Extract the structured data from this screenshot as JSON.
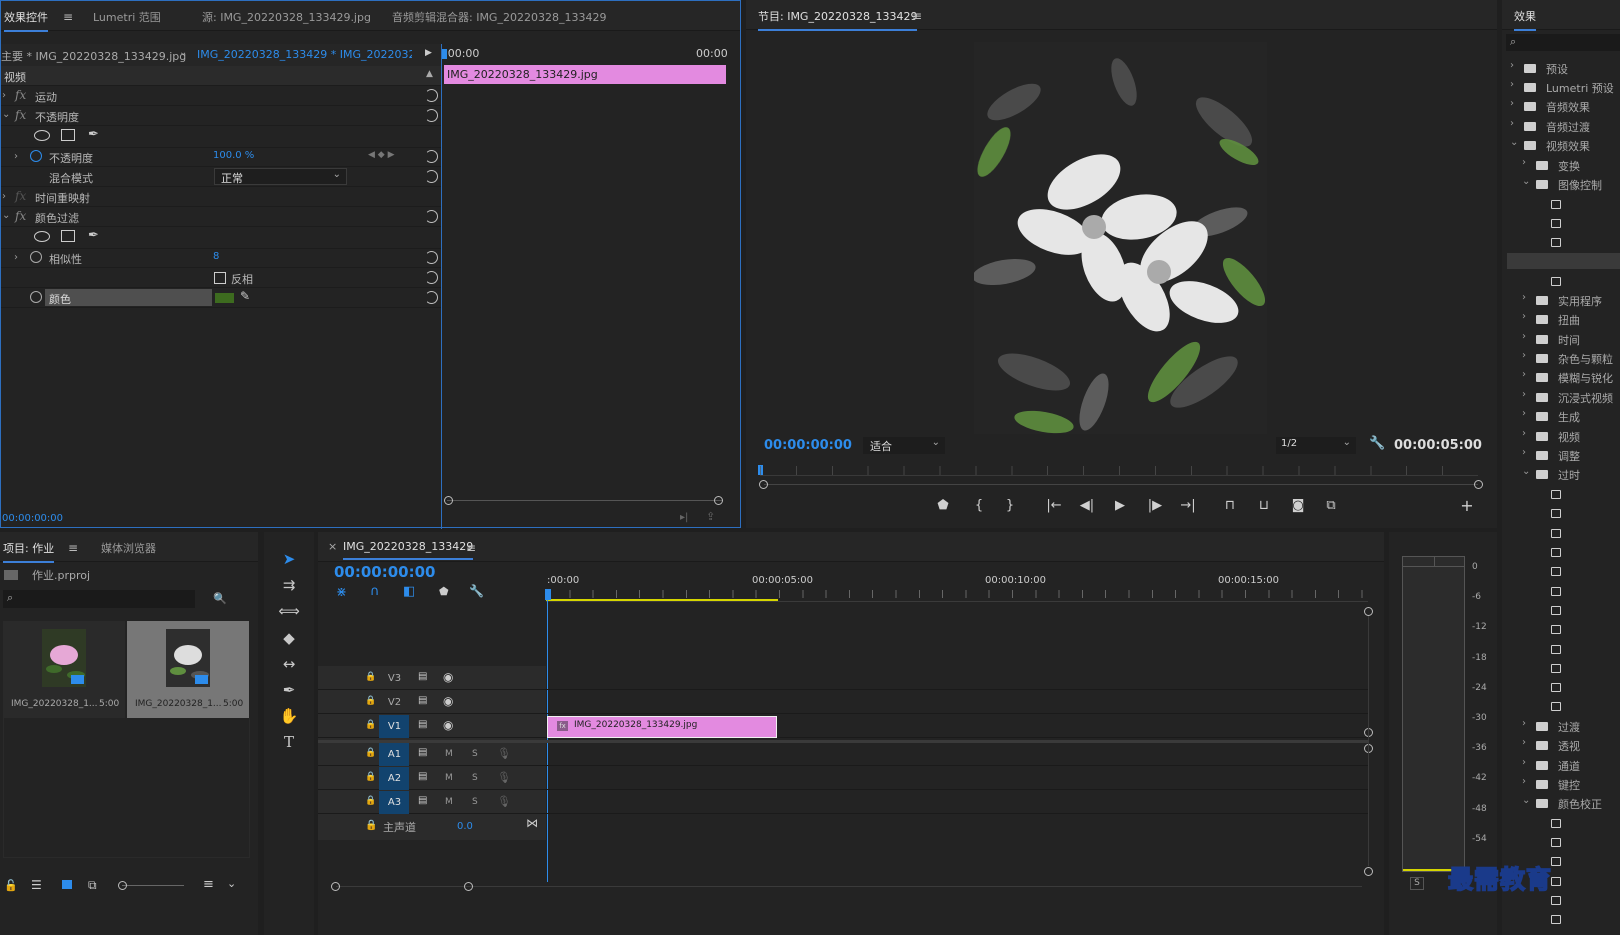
{
  "effects_panel": {
    "tabs": [
      "效果控件",
      "Lumetri 范围",
      "源: IMG_20220328_133429.jpg",
      "音频剪辑混合器: IMG_20220328_133429"
    ],
    "master_clip": "主要 * IMG_20220328_133429.jpg",
    "sequence_clip": "IMG_20220328_133429 * IMG_20220328_...",
    "time_start": ":00:00",
    "time_end": "00:00",
    "clip_bar_label": "IMG_20220328_133429.jpg",
    "section": "视频",
    "effects": {
      "motion": "运动",
      "opacity": "不透明度",
      "opacity_param": "不透明度",
      "opacity_value": "100.0 %",
      "blend_mode_label": "混合模式",
      "blend_mode_value": "正常",
      "time_remap": "时间重映射",
      "color_filter": "颜色过滤",
      "similarity_label": "相似性",
      "similarity_value": "8",
      "invert_label": "反相",
      "color_label": "颜色",
      "color_swatch": "#3d6b1f"
    },
    "footer_time": "00:00:00:00"
  },
  "program_monitor": {
    "title": "节目: IMG_20220328_133429",
    "timecode": "00:00:00:00",
    "zoom": "适合",
    "resolution": "1/2",
    "duration": "00:00:05:00"
  },
  "effects_browser": {
    "title": "效果",
    "items": [
      "预设",
      "Lumetri 预设",
      "音频效果",
      "音频过渡",
      "视频效果",
      "变换",
      "图像控制",
      "实用程序",
      "扭曲",
      "时间",
      "杂色与颗粒",
      "模糊与锐化",
      "沉浸式视频",
      "生成",
      "视频",
      "调整",
      "过时",
      "过渡",
      "透视",
      "通道",
      "键控",
      "颜色校正"
    ]
  },
  "project_panel": {
    "tabs": [
      "项目: 作业",
      "媒体浏览器"
    ],
    "project_file": "作业.prproj",
    "items": [
      {
        "name": "IMG_20220328_1...",
        "duration": "5:00"
      },
      {
        "name": "IMG_20220328_1...",
        "duration": "5:00"
      }
    ]
  },
  "timeline": {
    "title": "IMG_20220328_133429",
    "timecode": "00:00:00:00",
    "ruler": [
      ":00:00",
      "00:00:05:00",
      "00:00:10:00",
      "00:00:15:00"
    ],
    "video_tracks": [
      "V3",
      "V2",
      "V1"
    ],
    "audio_tracks": [
      "A1",
      "A2",
      "A3"
    ],
    "master_label": "主声道",
    "master_value": "0.0",
    "clip_label": "IMG_20220328_133429.jpg",
    "mute": "M",
    "solo": "S"
  },
  "audio_meter": {
    "scale": [
      "0",
      "-6",
      "-12",
      "-18",
      "-24",
      "-30",
      "-36",
      "-42",
      "-48",
      "-54"
    ],
    "solo": "S"
  },
  "watermark": "最需教育",
  "colors": {
    "accent_blue": "#2d8ceb",
    "clip_pink": "#e38ae0",
    "track_blue": "#12436e"
  }
}
